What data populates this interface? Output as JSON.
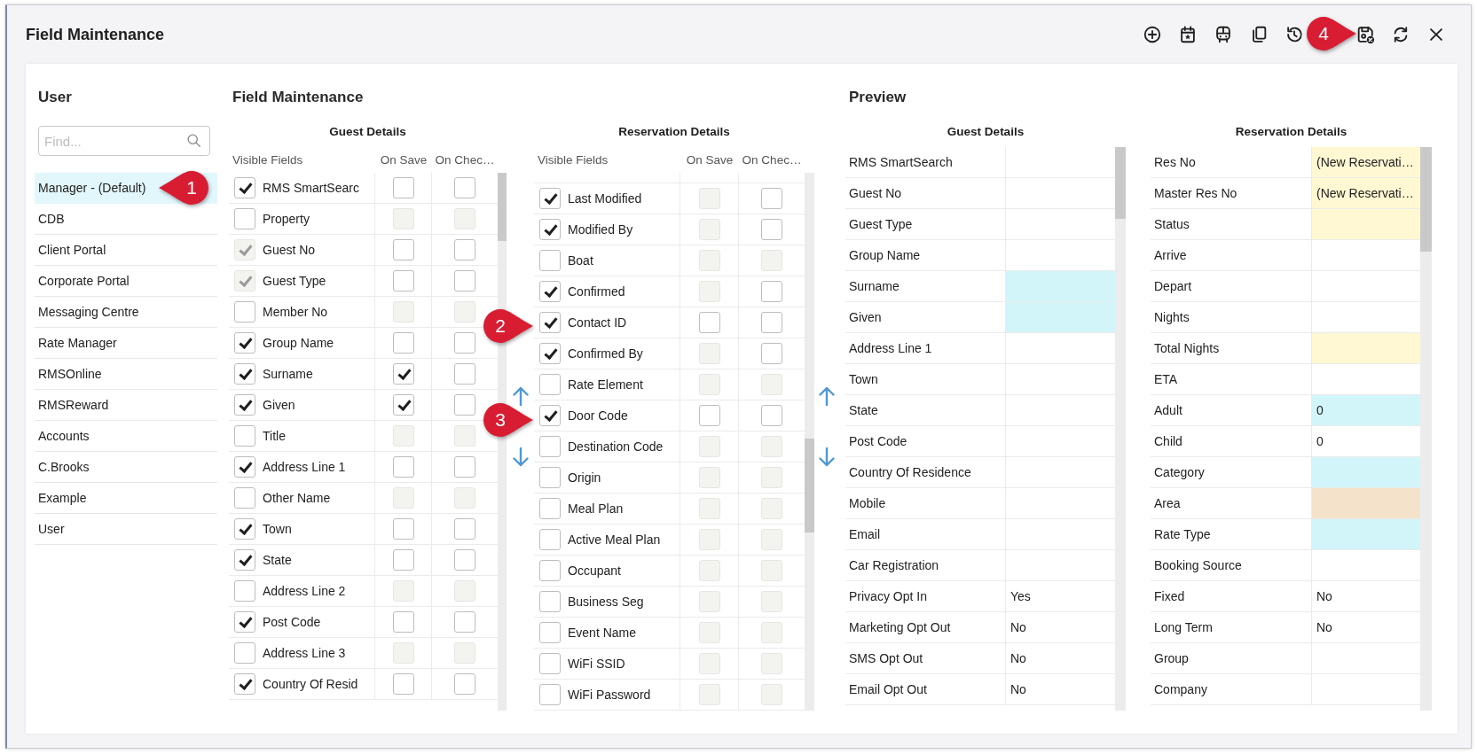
{
  "window": {
    "title": "Field Maintenance"
  },
  "callouts": [
    "1",
    "2",
    "3",
    "4"
  ],
  "user_panel": {
    "title": "User",
    "search": {
      "placeholder": "Find..."
    },
    "users": [
      {
        "name": "Manager - (Default)",
        "selected": true
      },
      {
        "name": "CDB",
        "selected": false
      },
      {
        "name": "Client Portal",
        "selected": false
      },
      {
        "name": "Corporate Portal",
        "selected": false
      },
      {
        "name": "Messaging Centre",
        "selected": false
      },
      {
        "name": "Rate Manager",
        "selected": false
      },
      {
        "name": "RMSOnline",
        "selected": false
      },
      {
        "name": "RMSReward",
        "selected": false
      },
      {
        "name": "Accounts",
        "selected": false
      },
      {
        "name": "C.Brooks",
        "selected": false
      },
      {
        "name": "Example",
        "selected": false
      },
      {
        "name": "User",
        "selected": false
      }
    ]
  },
  "field_maintenance": {
    "title": "Field Maintenance",
    "grids": [
      {
        "title": "Guest Details",
        "columns": [
          "Visible Fields",
          "On Save",
          "On Chec…"
        ],
        "rows": [
          {
            "label": "RMS SmartSearc",
            "visible": {
              "checked": true,
              "disabled": false
            },
            "on_save": {
              "checked": false,
              "disabled": false
            },
            "on_check": {
              "checked": false,
              "disabled": false
            }
          },
          {
            "label": "Property",
            "visible": {
              "checked": false,
              "disabled": false
            },
            "on_save": {
              "checked": false,
              "disabled": true
            },
            "on_check": {
              "checked": false,
              "disabled": true
            }
          },
          {
            "label": "Guest No",
            "visible": {
              "checked": true,
              "disabled": true
            },
            "on_save": {
              "checked": false,
              "disabled": false
            },
            "on_check": {
              "checked": false,
              "disabled": false
            }
          },
          {
            "label": "Guest Type",
            "visible": {
              "checked": true,
              "disabled": true
            },
            "on_save": {
              "checked": false,
              "disabled": false
            },
            "on_check": {
              "checked": false,
              "disabled": false
            }
          },
          {
            "label": "Member No",
            "visible": {
              "checked": false,
              "disabled": false
            },
            "on_save": {
              "checked": false,
              "disabled": true
            },
            "on_check": {
              "checked": false,
              "disabled": true
            }
          },
          {
            "label": "Group Name",
            "visible": {
              "checked": true,
              "disabled": false
            },
            "on_save": {
              "checked": false,
              "disabled": false
            },
            "on_check": {
              "checked": false,
              "disabled": false
            }
          },
          {
            "label": "Surname",
            "visible": {
              "checked": true,
              "disabled": false
            },
            "on_save": {
              "checked": true,
              "disabled": false
            },
            "on_check": {
              "checked": false,
              "disabled": false
            }
          },
          {
            "label": "Given",
            "visible": {
              "checked": true,
              "disabled": false
            },
            "on_save": {
              "checked": true,
              "disabled": false
            },
            "on_check": {
              "checked": false,
              "disabled": false
            }
          },
          {
            "label": "Title",
            "visible": {
              "checked": false,
              "disabled": false
            },
            "on_save": {
              "checked": false,
              "disabled": true
            },
            "on_check": {
              "checked": false,
              "disabled": true
            }
          },
          {
            "label": "Address Line 1",
            "visible": {
              "checked": true,
              "disabled": false
            },
            "on_save": {
              "checked": false,
              "disabled": false
            },
            "on_check": {
              "checked": false,
              "disabled": false
            }
          },
          {
            "label": "Other Name",
            "visible": {
              "checked": false,
              "disabled": false
            },
            "on_save": {
              "checked": false,
              "disabled": true
            },
            "on_check": {
              "checked": false,
              "disabled": true
            }
          },
          {
            "label": "Town",
            "visible": {
              "checked": true,
              "disabled": false
            },
            "on_save": {
              "checked": false,
              "disabled": false
            },
            "on_check": {
              "checked": false,
              "disabled": false
            }
          },
          {
            "label": "State",
            "visible": {
              "checked": true,
              "disabled": false
            },
            "on_save": {
              "checked": false,
              "disabled": false
            },
            "on_check": {
              "checked": false,
              "disabled": false
            }
          },
          {
            "label": "Address Line 2",
            "visible": {
              "checked": false,
              "disabled": false
            },
            "on_save": {
              "checked": false,
              "disabled": true
            },
            "on_check": {
              "checked": false,
              "disabled": true
            }
          },
          {
            "label": "Post Code",
            "visible": {
              "checked": true,
              "disabled": false
            },
            "on_save": {
              "checked": false,
              "disabled": false
            },
            "on_check": {
              "checked": false,
              "disabled": false
            }
          },
          {
            "label": "Address Line 3",
            "visible": {
              "checked": false,
              "disabled": false
            },
            "on_save": {
              "checked": false,
              "disabled": true
            },
            "on_check": {
              "checked": false,
              "disabled": true
            }
          },
          {
            "label": "Country Of Resid",
            "visible": {
              "checked": true,
              "disabled": false
            },
            "on_save": {
              "checked": false,
              "disabled": false
            },
            "on_check": {
              "checked": false,
              "disabled": false
            }
          }
        ]
      },
      {
        "title": "Reservation Details",
        "columns": [
          "Visible Fields",
          "On Save",
          "On Chec…"
        ],
        "rows": [
          {
            "label": "Last Modified",
            "visible": {
              "checked": true,
              "disabled": false
            },
            "on_save": {
              "checked": false,
              "disabled": true
            },
            "on_check": {
              "checked": false,
              "disabled": false
            }
          },
          {
            "label": "Modified By",
            "visible": {
              "checked": true,
              "disabled": false
            },
            "on_save": {
              "checked": false,
              "disabled": true
            },
            "on_check": {
              "checked": false,
              "disabled": false
            }
          },
          {
            "label": "Boat",
            "visible": {
              "checked": false,
              "disabled": false
            },
            "on_save": {
              "checked": false,
              "disabled": true
            },
            "on_check": {
              "checked": false,
              "disabled": true
            }
          },
          {
            "label": "Confirmed",
            "visible": {
              "checked": true,
              "disabled": false
            },
            "on_save": {
              "checked": false,
              "disabled": true
            },
            "on_check": {
              "checked": false,
              "disabled": false
            }
          },
          {
            "label": "Contact ID",
            "visible": {
              "checked": true,
              "disabled": false
            },
            "on_save": {
              "checked": false,
              "disabled": false
            },
            "on_check": {
              "checked": false,
              "disabled": false
            }
          },
          {
            "label": "Confirmed By",
            "visible": {
              "checked": true,
              "disabled": false
            },
            "on_save": {
              "checked": false,
              "disabled": true
            },
            "on_check": {
              "checked": false,
              "disabled": false
            }
          },
          {
            "label": "Rate Element",
            "visible": {
              "checked": false,
              "disabled": false
            },
            "on_save": {
              "checked": false,
              "disabled": true
            },
            "on_check": {
              "checked": false,
              "disabled": true
            }
          },
          {
            "label": "Door Code",
            "visible": {
              "checked": true,
              "disabled": false
            },
            "on_save": {
              "checked": false,
              "disabled": false
            },
            "on_check": {
              "checked": false,
              "disabled": false
            }
          },
          {
            "label": "Destination Code",
            "visible": {
              "checked": false,
              "disabled": false
            },
            "on_save": {
              "checked": false,
              "disabled": true
            },
            "on_check": {
              "checked": false,
              "disabled": true
            }
          },
          {
            "label": "Origin",
            "visible": {
              "checked": false,
              "disabled": false
            },
            "on_save": {
              "checked": false,
              "disabled": true
            },
            "on_check": {
              "checked": false,
              "disabled": true
            }
          },
          {
            "label": "Meal Plan",
            "visible": {
              "checked": false,
              "disabled": false
            },
            "on_save": {
              "checked": false,
              "disabled": true
            },
            "on_check": {
              "checked": false,
              "disabled": true
            }
          },
          {
            "label": "Active Meal Plan",
            "visible": {
              "checked": false,
              "disabled": false
            },
            "on_save": {
              "checked": false,
              "disabled": true
            },
            "on_check": {
              "checked": false,
              "disabled": true
            }
          },
          {
            "label": "Occupant",
            "visible": {
              "checked": false,
              "disabled": false
            },
            "on_save": {
              "checked": false,
              "disabled": true
            },
            "on_check": {
              "checked": false,
              "disabled": true
            }
          },
          {
            "label": "Business Seg",
            "visible": {
              "checked": false,
              "disabled": false
            },
            "on_save": {
              "checked": false,
              "disabled": true
            },
            "on_check": {
              "checked": false,
              "disabled": true
            }
          },
          {
            "label": "Event Name",
            "visible": {
              "checked": false,
              "disabled": false
            },
            "on_save": {
              "checked": false,
              "disabled": true
            },
            "on_check": {
              "checked": false,
              "disabled": true
            }
          },
          {
            "label": "WiFi SSID",
            "visible": {
              "checked": false,
              "disabled": false
            },
            "on_save": {
              "checked": false,
              "disabled": true
            },
            "on_check": {
              "checked": false,
              "disabled": true
            }
          },
          {
            "label": "WiFi Password",
            "visible": {
              "checked": false,
              "disabled": false
            },
            "on_save": {
              "checked": false,
              "disabled": true
            },
            "on_check": {
              "checked": false,
              "disabled": true
            }
          }
        ]
      }
    ]
  },
  "preview": {
    "title": "Preview",
    "tables": [
      {
        "title": "Guest Details",
        "rows": [
          {
            "label": "RMS SmartSearch"
          },
          {
            "label": "Guest No"
          },
          {
            "label": "Guest Type"
          },
          {
            "label": "Group Name"
          },
          {
            "label": "Surname",
            "color": "#d2f5fa"
          },
          {
            "label": "Given",
            "color": "#d2f5fa"
          },
          {
            "label": "Address Line 1"
          },
          {
            "label": "Town"
          },
          {
            "label": "State"
          },
          {
            "label": "Post Code"
          },
          {
            "label": "Country Of Residence"
          },
          {
            "label": "Mobile"
          },
          {
            "label": "Email"
          },
          {
            "label": "Car Registration"
          },
          {
            "label": "Privacy Opt In",
            "value": "Yes"
          },
          {
            "label": "Marketing Opt Out",
            "value": "No"
          },
          {
            "label": "SMS Opt Out",
            "value": "No"
          },
          {
            "label": "Email Opt Out",
            "value": "No"
          }
        ]
      },
      {
        "title": "Reservation Details",
        "rows": [
          {
            "label": "Res No",
            "value": "(New Reservati…",
            "color": "#fff8d2"
          },
          {
            "label": "Master Res No",
            "value": "(New Reservati…",
            "color": "#fff8d2"
          },
          {
            "label": "Status",
            "color": "#fff8d2"
          },
          {
            "label": "Arrive"
          },
          {
            "label": "Depart"
          },
          {
            "label": "Nights"
          },
          {
            "label": "Total Nights",
            "color": "#fff8d2"
          },
          {
            "label": "ETA"
          },
          {
            "label": "Adult",
            "value": "0",
            "color": "#d2f5fa"
          },
          {
            "label": "Child",
            "value": "0"
          },
          {
            "label": "Category",
            "color": "#d2f5fa"
          },
          {
            "label": "Area",
            "color": "#f5e2cb"
          },
          {
            "label": "Rate Type",
            "color": "#d2f5fa"
          },
          {
            "label": "Booking Source"
          },
          {
            "label": "Fixed",
            "value": "No"
          },
          {
            "label": "Long Term",
            "value": "No"
          },
          {
            "label": "Group"
          },
          {
            "label": "Company"
          }
        ]
      }
    ]
  }
}
